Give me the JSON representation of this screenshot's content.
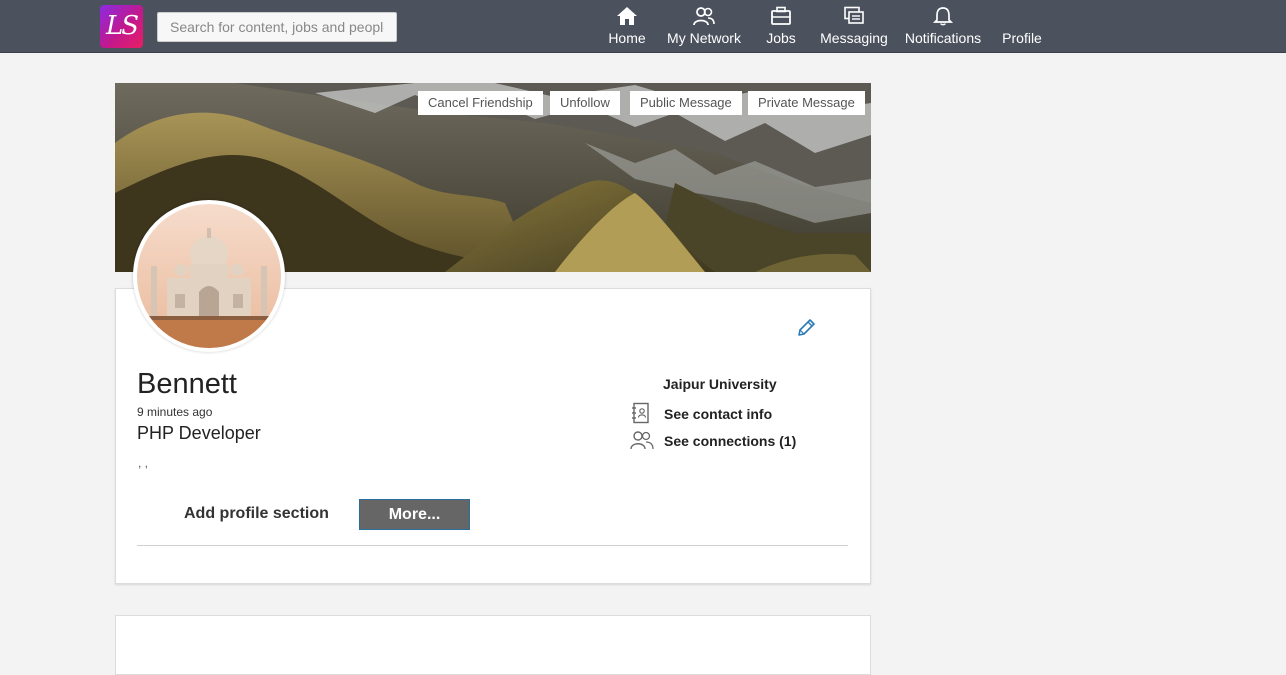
{
  "nav": {
    "logo_text": "LS",
    "search_placeholder": "Search for content, jobs and people",
    "items": [
      {
        "label": "Home",
        "icon": "home-icon"
      },
      {
        "label": "My Network",
        "icon": "network-icon"
      },
      {
        "label": "Jobs",
        "icon": "briefcase-icon"
      },
      {
        "label": "Messaging",
        "icon": "messaging-icon"
      },
      {
        "label": "Notifications",
        "icon": "bell-icon"
      },
      {
        "label": "Profile",
        "icon": ""
      }
    ]
  },
  "cover": {
    "buttons": [
      "Cancel Friendship",
      "Unfollow",
      "Public Message",
      "Private Message"
    ]
  },
  "profile": {
    "name": "Bennett",
    "updated": "9 minutes ago",
    "headline": "PHP Developer",
    "location": ", ,",
    "university": "Jaipur University",
    "contact_link": "See contact info",
    "connections_link": "See connections (1)",
    "add_section": "Add profile section",
    "more_button": "More..."
  },
  "colors": {
    "topbar": "#4b515d",
    "background": "#f3f3f3",
    "edit_icon": "#2a7ab8",
    "more_button": "#666666"
  }
}
